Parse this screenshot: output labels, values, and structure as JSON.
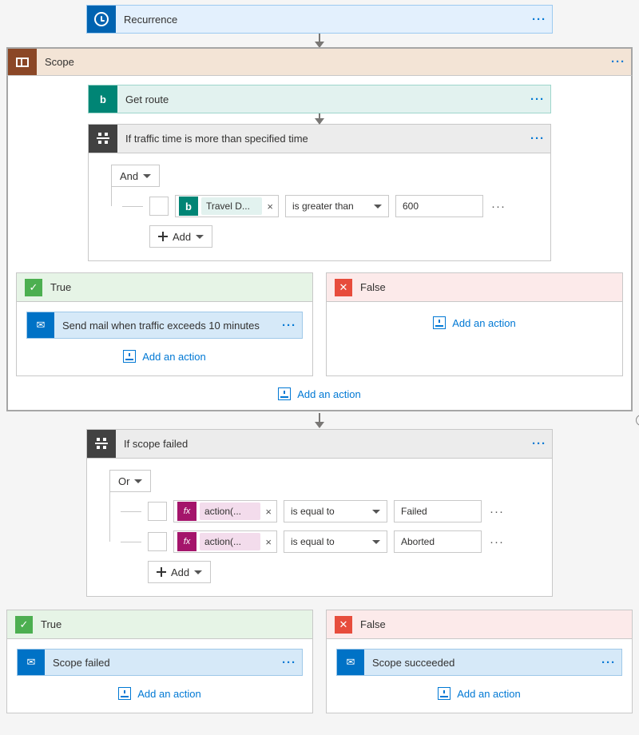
{
  "recurrence": {
    "title": "Recurrence"
  },
  "scope": {
    "title": "Scope"
  },
  "getRoute": {
    "title": "Get route"
  },
  "cond1": {
    "title": "If traffic time is more than specified time",
    "logic": "And",
    "addLabel": "Add",
    "rows": [
      {
        "token": "Travel D...",
        "op": "is greater than",
        "val": "600"
      }
    ]
  },
  "branchesA": {
    "true": {
      "label": "True",
      "action": "Send mail when traffic exceeds 10 minutes"
    },
    "false": {
      "label": "False"
    }
  },
  "cond2": {
    "title": "If scope failed",
    "logic": "Or",
    "addLabel": "Add",
    "rows": [
      {
        "token": "action(...",
        "op": "is equal to",
        "val": "Failed"
      },
      {
        "token": "action(...",
        "op": "is equal to",
        "val": "Aborted"
      }
    ]
  },
  "branchesB": {
    "true": {
      "label": "True",
      "action": "Scope failed"
    },
    "false": {
      "label": "False",
      "action": "Scope succeeded"
    }
  },
  "ui": {
    "addAction": "Add an action",
    "bingGlyph": "b",
    "fxGlyph": "fx"
  }
}
